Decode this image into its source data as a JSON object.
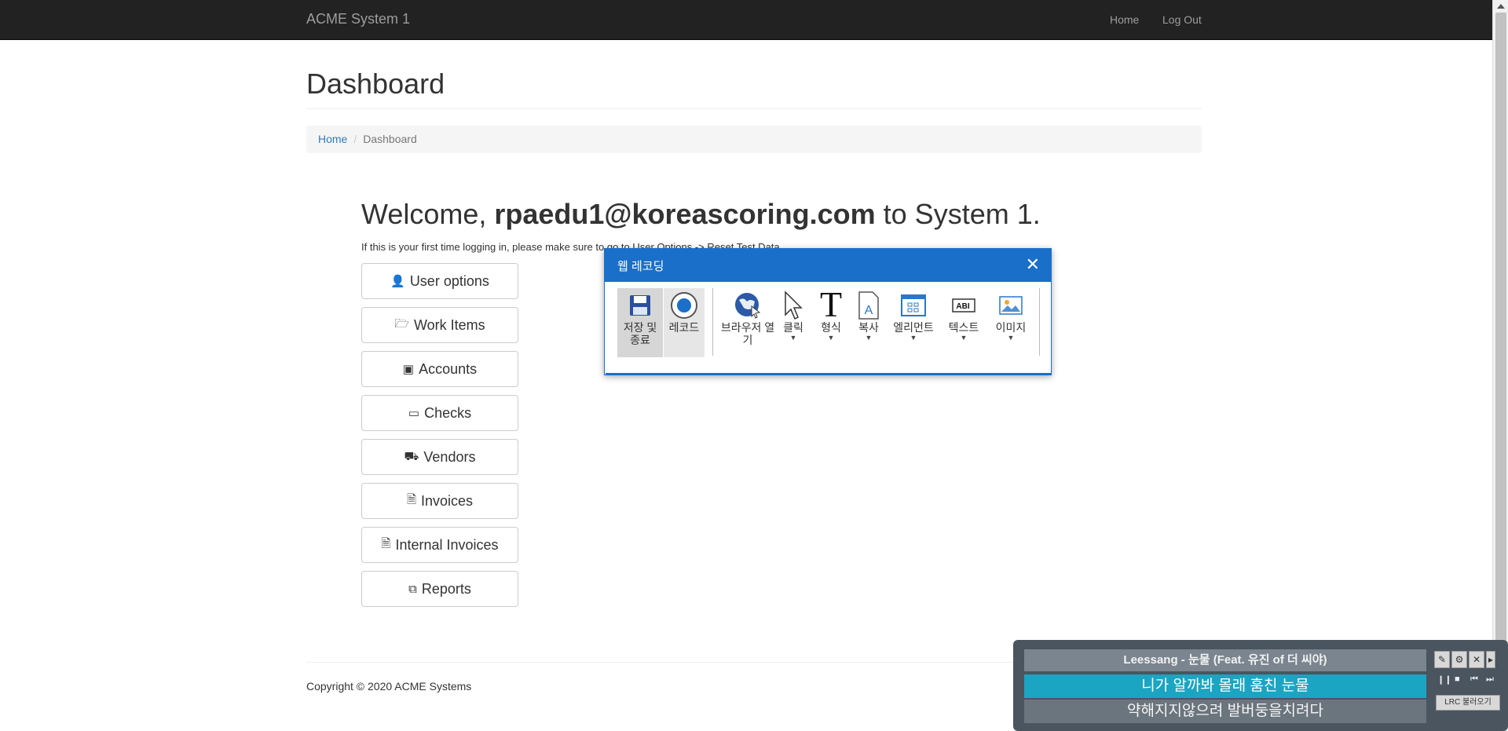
{
  "navbar": {
    "brand": "ACME System 1",
    "home": "Home",
    "logout": "Log Out"
  },
  "page": {
    "title": "Dashboard",
    "breadcrumb": {
      "home": "Home",
      "separator": "/",
      "current": "Dashboard"
    },
    "welcome_prefix": "Welcome, ",
    "user_email": "rpaedu1@koreascoring.com",
    "welcome_suffix": " to System 1.",
    "first_time_note": "If this is your first time logging in, please make sure to go to User Options -> Reset Test Data."
  },
  "menu": [
    {
      "label": "User options",
      "icon": "user-icon"
    },
    {
      "label": "Work Items",
      "icon": "folder-open-icon"
    },
    {
      "label": "Accounts",
      "icon": "money-icon"
    },
    {
      "label": "Checks",
      "icon": "credit-card-icon"
    },
    {
      "label": "Vendors",
      "icon": "truck-icon"
    },
    {
      "label": "Invoices",
      "icon": "file-text-icon"
    },
    {
      "label": "Internal Invoices",
      "icon": "file-text-icon"
    },
    {
      "label": "Reports",
      "icon": "copy-icon"
    }
  ],
  "footer": {
    "copyright": "Copyright © 2020 ACME Systems"
  },
  "recorder": {
    "title": "웹 레코딩",
    "tools": {
      "save": "저장 및 종료",
      "record": "레코드",
      "open_browser": "브라우저 열기",
      "click": "클릭",
      "type": "형식",
      "copy": "복사",
      "element": "엘리먼트",
      "text": "텍스트",
      "image": "이미지"
    },
    "accent_color": "#1a6fc9"
  },
  "lyrics_player": {
    "song": "Leessang - 눈물 (Feat. 유진 of 더 씨야)",
    "current_line": "니가 알까봐 몰래 훔친 눈물",
    "next_line": "약해지지않으려 발버둥을치려다",
    "lrc_button": "LRC 불러오기"
  }
}
